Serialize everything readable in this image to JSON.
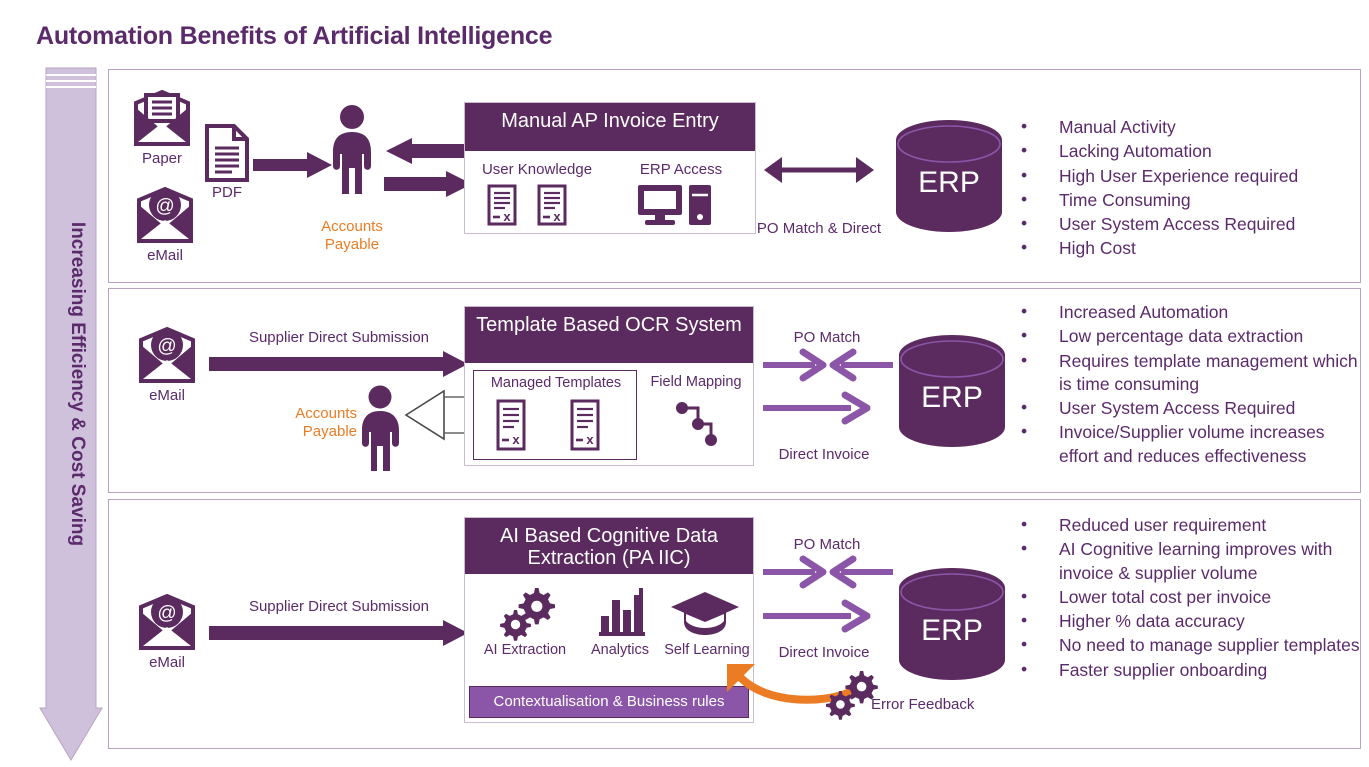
{
  "title": "Automation Benefits of Artificial Intelligence",
  "axis": {
    "label": "Increasing Efficiency & Cost Saving"
  },
  "colors": {
    "dark_purple": "#5B2A5E",
    "title_purple": "#5B2A6B",
    "mid_purple": "#8C56A8",
    "light_lavender": "#CFC0DC",
    "orange": "#EC7C23",
    "gray_arrow": "#8D8D8D",
    "frame_border": "#B9A3C3"
  },
  "rows": [
    {
      "id": "manual",
      "inputs": [
        {
          "icon": "envelope-icon",
          "label": "Paper"
        },
        {
          "icon": "document-icon",
          "label": "PDF"
        },
        {
          "icon": "email-envelope-icon",
          "label": "eMail"
        }
      ],
      "actor": {
        "icon": "person-icon",
        "label_line1": "Accounts",
        "label_line2": "Payable"
      },
      "system": {
        "header": "Manual AP Invoice Entry",
        "features": [
          {
            "label": "User Knowledge",
            "icon": "document-x-icon"
          },
          {
            "label": "ERP Access",
            "icon": "desktop-tower-icon"
          }
        ]
      },
      "connector": {
        "type": "double-arrow",
        "label": "PO Match & Direct"
      },
      "erp": {
        "label": "ERP"
      },
      "bullets": [
        "Manual Activity",
        "Lacking Automation",
        "High User Experience required",
        "Time Consuming",
        "User System Access Required",
        "High Cost"
      ]
    },
    {
      "id": "ocr",
      "inputs": [
        {
          "icon": "email-envelope-icon",
          "label": "eMail"
        }
      ],
      "flow_label": "Supplier Direct Submission",
      "actor": {
        "icon": "person-icon",
        "label_line1": "Accounts",
        "label_line2": "Payable"
      },
      "system": {
        "header": "Template Based OCR System",
        "features": [
          {
            "label": "Managed Templates",
            "icon": "document-x-icon"
          },
          {
            "label": "Field Mapping",
            "icon": "node-map-icon"
          }
        ]
      },
      "connector": {
        "type": "po-match-direct",
        "label_top": "PO Match",
        "label_bottom": "Direct Invoice"
      },
      "erp": {
        "label": "ERP"
      },
      "bullets": [
        "Increased Automation",
        "Low percentage data extraction",
        "Requires template management which is time consuming",
        "User System Access Required",
        "Invoice/Supplier volume increases effort and reduces effectiveness"
      ]
    },
    {
      "id": "ai",
      "inputs": [
        {
          "icon": "email-envelope-icon",
          "label": "eMail"
        }
      ],
      "flow_label": "Supplier Direct Submission",
      "system": {
        "header": "AI Based Cognitive Data Extraction (PA IIC)",
        "features": [
          {
            "label": "AI Extraction",
            "icon": "gears-icon"
          },
          {
            "label": "Analytics",
            "icon": "bar-chart-icon"
          },
          {
            "label": "Self Learning",
            "icon": "graduation-cap-icon"
          }
        ],
        "footer": "Contextualisation & Business rules"
      },
      "connector": {
        "type": "po-match-direct",
        "label_top": "PO Match",
        "label_bottom": "Direct Invoice"
      },
      "feedback": {
        "icon": "gears-icon",
        "label": "Error Feedback",
        "arrow": "orange-curved-arrow"
      },
      "erp": {
        "label": "ERP"
      },
      "bullets": [
        "Reduced user requirement",
        "AI Cognitive learning improves with invoice & supplier volume",
        "Lower total cost per invoice",
        "Higher % data accuracy",
        "No need to manage supplier templates",
        "Faster supplier onboarding"
      ]
    }
  ]
}
